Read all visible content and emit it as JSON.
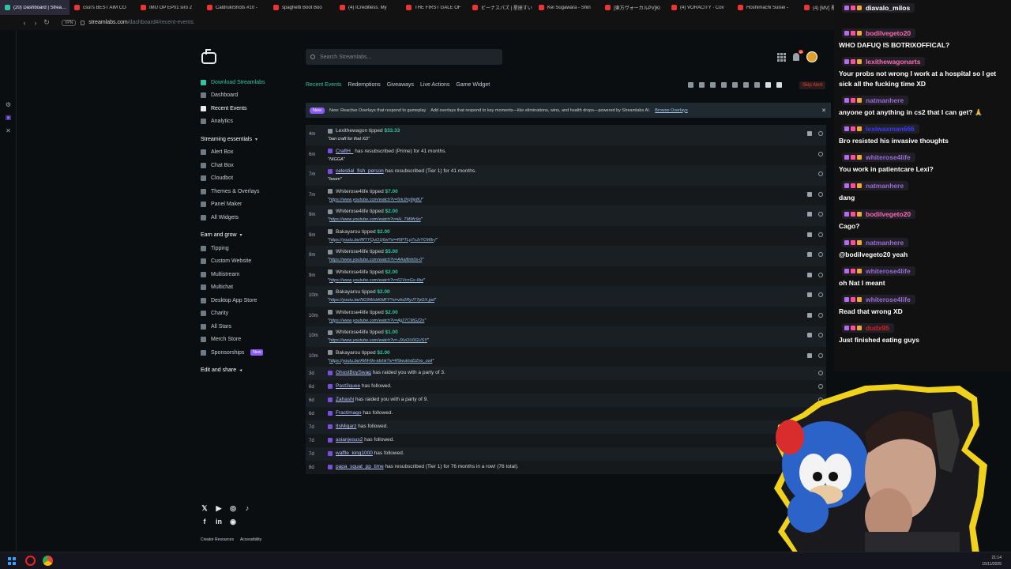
{
  "browser": {
    "tabs": [
      {
        "label": "(20) Dashboard | Streamlabs",
        "active": true
      },
      {
        "label": "csul's BEST AIM CO"
      },
      {
        "label": "IMU OP EP01 siro 2"
      },
      {
        "label": "CaldrukiShots #10 -"
      },
      {
        "label": "spaghetti Boot Boo"
      },
      {
        "label": "(4) ICreditless. My"
      },
      {
        "label": "THE FIRST GALE OF"
      },
      {
        "label": "ビーナスパズ | 星座すい"
      },
      {
        "label": "Kei Sugawara - Shin"
      },
      {
        "label": "[東方ヴォーカルPV]Kl"
      },
      {
        "label": "(4) VORACITY · Cov"
      },
      {
        "label": "Hoshimachi Suisei -"
      },
      {
        "label": "(4) [MV] 星街"
      }
    ],
    "vpn_label": "VPN",
    "url_host": "streamlabs.com",
    "url_path": "/dashboard#/recent-events",
    "new_tab_button": "+"
  },
  "search": {
    "placeholder": "Search Streamlabs..."
  },
  "notifications_count": "11",
  "nav": {
    "download": "Download Streamlabs",
    "dashboard": "Dashboard",
    "recent_events": "Recent Events",
    "analytics": "Analytics",
    "streaming_essentials": "Streaming essentials",
    "streaming_items": [
      "Alert Box",
      "Chat Box",
      "Cloudbot",
      "Themes & Overlays",
      "Panel Maker",
      "All Widgets"
    ],
    "earn_and_grow": "Earn and grow",
    "earn_items": [
      "Tipping",
      "Custom Website",
      "Multistream",
      "Multichat",
      "Desktop App Store",
      "Charity",
      "All Stars",
      "Merch Store",
      "Sponsorships"
    ],
    "sponsorships_badge": "New",
    "edit_and_share": "Edit and share"
  },
  "footer": {
    "creator_resources": "Creator Resources",
    "accessibility": "Accessibility"
  },
  "tabs": [
    "Recent Events",
    "Redemptions",
    "Giveaways",
    "Live Actions",
    "Game Widget"
  ],
  "skip_alert": "Skip Alert",
  "banner": {
    "badge": "New",
    "title": "New: Reactive Overlays that respond to gameplay",
    "text": "Add overlays that respond to key moments—like eliminations, wins, and health drops—powered by Streamlabs AI.",
    "link": "Browse Overlays"
  },
  "events": [
    {
      "age": "4m",
      "name": "Lexithewagon",
      "action": " tipped ",
      "amount": "$33.33",
      "message": "\"ban craft for that XD\""
    },
    {
      "age": "6m",
      "name": "CraftH_",
      "action": " has resubscribed (Prime) for 41 months.",
      "message": "\"NIGGA\""
    },
    {
      "age": "7m",
      "name": "celestial_fish_person",
      "action": " has resubscribed (Tier 1) for 41 months.",
      "message": "\"boom\""
    },
    {
      "age": "7m",
      "name": "Whiterose4life",
      "action": " tipped ",
      "amount": "$7.00",
      "link": "https://www.youtube.com/watch?v=5rkJhq9ip8U"
    },
    {
      "age": "9m",
      "name": "Whiterose4life",
      "action": " tipped ",
      "amount": "$2.00",
      "link": "https://www.youtube.com/watch?v=iH_TM9fc9o"
    },
    {
      "age": "9m",
      "name": "Bakayarou",
      "action": " tipped ",
      "amount": "$2.00",
      "link": "https://youtu.be/RfTYQuO1j6w?si=45PTLp7sJvYOWb-j"
    },
    {
      "age": "9m",
      "name": "Whiterose4life",
      "action": " tipped ",
      "amount": "$5.00",
      "link": "https://www.youtube.com/watch?v=AAalltnb0s-0"
    },
    {
      "age": "9m",
      "name": "Whiterose4life",
      "action": " tipped ",
      "amount": "$2.00",
      "link": "https://www.youtube.com/watch?v=61VcnGx-6tw"
    },
    {
      "age": "10m",
      "name": "Bakayarou",
      "action": " tipped ",
      "amount": "$2.00",
      "link": "https://youtu.be/NG9WcbKfdFY?si=zfo2RyJT7pGX.jpd"
    },
    {
      "age": "10m",
      "name": "Whiterose4life",
      "action": " tipped ",
      "amount": "$2.00",
      "link": "https://www.youtube.com/watch?v=Ajj27C9tGZ2s"
    },
    {
      "age": "10m",
      "name": "Whiterose4life",
      "action": " tipped ",
      "amount": "$1.00",
      "link": "https://www.youtube.com/watch?v=-JXvOU0GUSY"
    },
    {
      "age": "10m",
      "name": "Bakayarou",
      "action": " tipped ",
      "amount": "$2.00",
      "link": "https://youtu.be/AWH9n-idshk?si=R9wukistDZno_owt"
    },
    {
      "age": "3d",
      "name": "GhostBoySwag",
      "action": " has raided you with a party of 3."
    },
    {
      "age": "6d",
      "name": "Past3quee",
      "action": " has followed."
    },
    {
      "age": "6d",
      "name": "Zahashi",
      "action": " has raided you with a party of 9."
    },
    {
      "age": "6d",
      "name": "Fractimago",
      "action": " has followed."
    },
    {
      "age": "7d",
      "name": "ItsMigarz",
      "action": " has followed."
    },
    {
      "age": "7d",
      "name": "asianjesus2",
      "action": " has followed."
    },
    {
      "age": "7d",
      "name": "waffle_king1000",
      "action": " has followed."
    },
    {
      "age": "8d",
      "name": "papa_squat_pp_time",
      "action": " has resubscribed (Tier 1) for 76 months in a row! (76 total)."
    }
  ],
  "chat": [
    {
      "user": "diavalo_milos",
      "color": "#ffffff",
      "text": ""
    },
    {
      "user": "bodilvegeto20",
      "color": "#ff69b4",
      "text": "WHO DAFUQ IS BOTRIXOFFICAL?"
    },
    {
      "user": "lexithewagonarts",
      "color": "#ff69b4",
      "text": "Your probs not wrong I work at a hospital so I get sick all the fucking time XD"
    },
    {
      "user": "natmanhere",
      "color": "#9a6bd8",
      "text": "anyone got anything in cs2 that I can get? 🙏"
    },
    {
      "user": "lexiwaxman666",
      "color": "#3b3bff",
      "text": "Bro resisted his invasive thoughts"
    },
    {
      "user": "whiterose4life",
      "color": "#9a6bd8",
      "text": "You work in patientcare Lexi?"
    },
    {
      "user": "natmanhere",
      "color": "#9a6bd8",
      "text": "dang"
    },
    {
      "user": "bodilvegeto20",
      "color": "#ff69b4",
      "text": "Cago?"
    },
    {
      "user": "natmanhere",
      "color": "#9a6bd8",
      "text": "@bodilvegeto20 yeah"
    },
    {
      "user": "whiterose4life",
      "color": "#9a6bd8",
      "text": "oh Nat I meant"
    },
    {
      "user": "whiterose4life",
      "color": "#9a6bd8",
      "text": "Read that wrong XD"
    },
    {
      "user": "dudx95",
      "color": "#d62020",
      "text": "Just finished eating guys"
    }
  ],
  "clock": {
    "time": "21:14",
    "date": "15/11/2025"
  },
  "colors": {
    "accent": "#31c3a2",
    "tip": "#31c3a2",
    "danger": "#e4452f",
    "new_badge": "#8a5cf5"
  }
}
